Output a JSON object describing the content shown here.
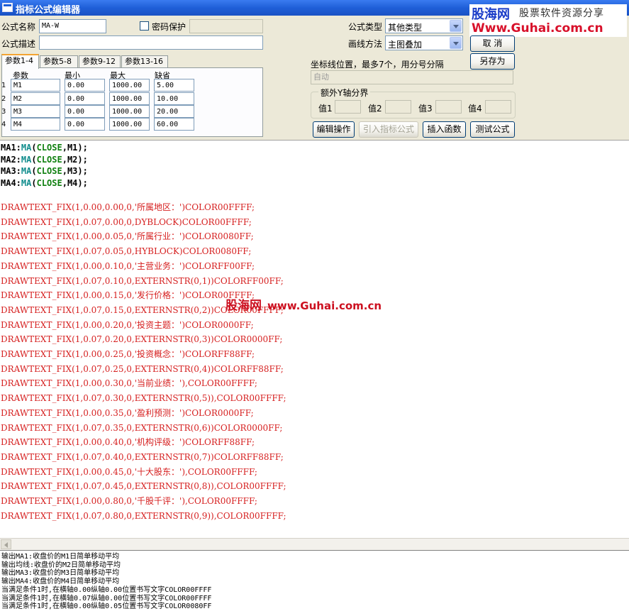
{
  "window": {
    "title": "指标公式编辑器"
  },
  "brand": {
    "logo": "股海网",
    "slogan": "股票软件资源分享",
    "url": "Www.Guhai.com.cn"
  },
  "form": {
    "name_label": "公式名称",
    "name_value": "MA-W",
    "password_label": "密码保护",
    "password_value": "",
    "desc_label": "公式描述",
    "desc_value": "",
    "type_label": "公式类型",
    "type_value": "其他类型",
    "draw_label": "画线方法",
    "draw_value": "主图叠加"
  },
  "buttons": {
    "cancel": "取  消",
    "saveas": "另存为",
    "edit": "编辑操作",
    "import": "引入指标公式",
    "insert": "插入函数",
    "test": "测试公式"
  },
  "axis": {
    "label": "坐标线位置，最多7个，用分号分隔",
    "value": "自动",
    "extra_title": "额外Y轴分界",
    "v1": "值1",
    "v2": "值2",
    "v3": "值3",
    "v4": "值4"
  },
  "tabs": [
    "参数1-4",
    "参数5-8",
    "参数9-12",
    "参数13-16"
  ],
  "params": {
    "headers": [
      "参数",
      "最小",
      "最大",
      "缺省"
    ],
    "rows": [
      {
        "n": "1",
        "name": "M1",
        "min": "0.00",
        "max": "1000.00",
        "def": "5.00"
      },
      {
        "n": "2",
        "name": "M2",
        "min": "0.00",
        "max": "1000.00",
        "def": "10.00"
      },
      {
        "n": "3",
        "name": "M3",
        "min": "0.00",
        "max": "1000.00",
        "def": "20.00"
      },
      {
        "n": "4",
        "name": "M4",
        "min": "0.00",
        "max": "1000.00",
        "def": "60.00"
      }
    ]
  },
  "code_ma": [
    {
      "var": "MA1:",
      "fn": "MA",
      "p1": "(",
      "kw": "CLOSE",
      "rest": ",M1);"
    },
    {
      "var": "MA2:",
      "fn": "MA",
      "p1": "(",
      "kw": "CLOSE",
      "rest": ",M2);"
    },
    {
      "var": "MA3:",
      "fn": "MA",
      "p1": "(",
      "kw": "CLOSE",
      "rest": ",M3);"
    },
    {
      "var": "MA4:",
      "fn": "MA",
      "p1": "(",
      "kw": "CLOSE",
      "rest": ",M4);"
    }
  ],
  "code_draw": [
    "DRAWTEXT_FIX(1,0.00,0.00,0,'所属地区：')COLOR00FFFF;",
    "DRAWTEXT_FIX(1,0.07,0.00,0,DYBLOCK)COLOR00FFFF;",
    "DRAWTEXT_FIX(1,0.00,0.05,0,'所属行业：')COLOR0080FF;",
    "DRAWTEXT_FIX(1,0.07,0.05,0,HYBLOCK)COLOR0080FF;",
    "DRAWTEXT_FIX(1,0.00,0.10,0,'主营业务：')COLORFF00FF;",
    "DRAWTEXT_FIX(1,0.07,0.10,0,EXTERNSTR(0,1))COLORFF00FF;",
    "DRAWTEXT_FIX(1,0.00,0.15,0,'发行价格：')COLOR00FFFF;",
    "DRAWTEXT_FIX(1,0.07,0.15,0,EXTERNSTR(0,2))COLOR00FFFF;",
    "DRAWTEXT_FIX(1,0.00,0.20,0,'投资主题：')COLOR0000FF;",
    "DRAWTEXT_FIX(1,0.07,0.20,0,EXTERNSTR(0,3))COLOR0000FF;",
    "DRAWTEXT_FIX(1,0.00,0.25,0,'投资概念：')COLORFF88FF;",
    "DRAWTEXT_FIX(1,0.07,0.25,0,EXTERNSTR(0,4))COLORFF88FF;",
    "DRAWTEXT_FIX(1,0.00,0.30,0,'当前业绩：'),COLOR00FFFF;",
    "DRAWTEXT_FIX(1,0.07,0.30,0,EXTERNSTR(0,5)),COLOR00FFFF;",
    "DRAWTEXT_FIX(1,0.00,0.35,0,'盈利预测：')COLOR0000FF;",
    "DRAWTEXT_FIX(1,0.07,0.35,0,EXTERNSTR(0,6))COLOR0000FF;",
    "DRAWTEXT_FIX(1,0.00,0.40,0,'机构评级：')COLORFF88FF;",
    "DRAWTEXT_FIX(1,0.07,0.40,0,EXTERNSTR(0,7))COLORFF88FF;",
    "DRAWTEXT_FIX(1,0.00,0.45,0,'十大股东：'),COLOR00FFFF;",
    "DRAWTEXT_FIX(1,0.07,0.45,0,EXTERNSTR(0,8)),COLOR00FFFF;",
    "DRAWTEXT_FIX(1,0.00,0.80,0,'千股千评：'),COLOR00FFFF;",
    "DRAWTEXT_FIX(1,0.07,0.80,0,EXTERNSTR(0,9)),COLOR00FFFF;"
  ],
  "watermark": {
    "logo": "股海网",
    "url": "www.Guhai.com.cn"
  },
  "output": [
    "输出MA1:收盘价的M1日简单移动平均",
    "输出均线:收盘价的M2日简单移动平均",
    "输出MA3:收盘价的M3日简单移动平均",
    "输出MA4:收盘价的M4日简单移动平均",
    "当满足条件1时,在横轴0.00纵轴0.00位置书写文字COLOR00FFFF",
    "当满足条件1时,在横轴0.07纵轴0.00位置书写文字COLOR00FFFF",
    "当满足条件1时,在横轴0.00纵轴0.05位置书写文字COLOR0080FF"
  ]
}
